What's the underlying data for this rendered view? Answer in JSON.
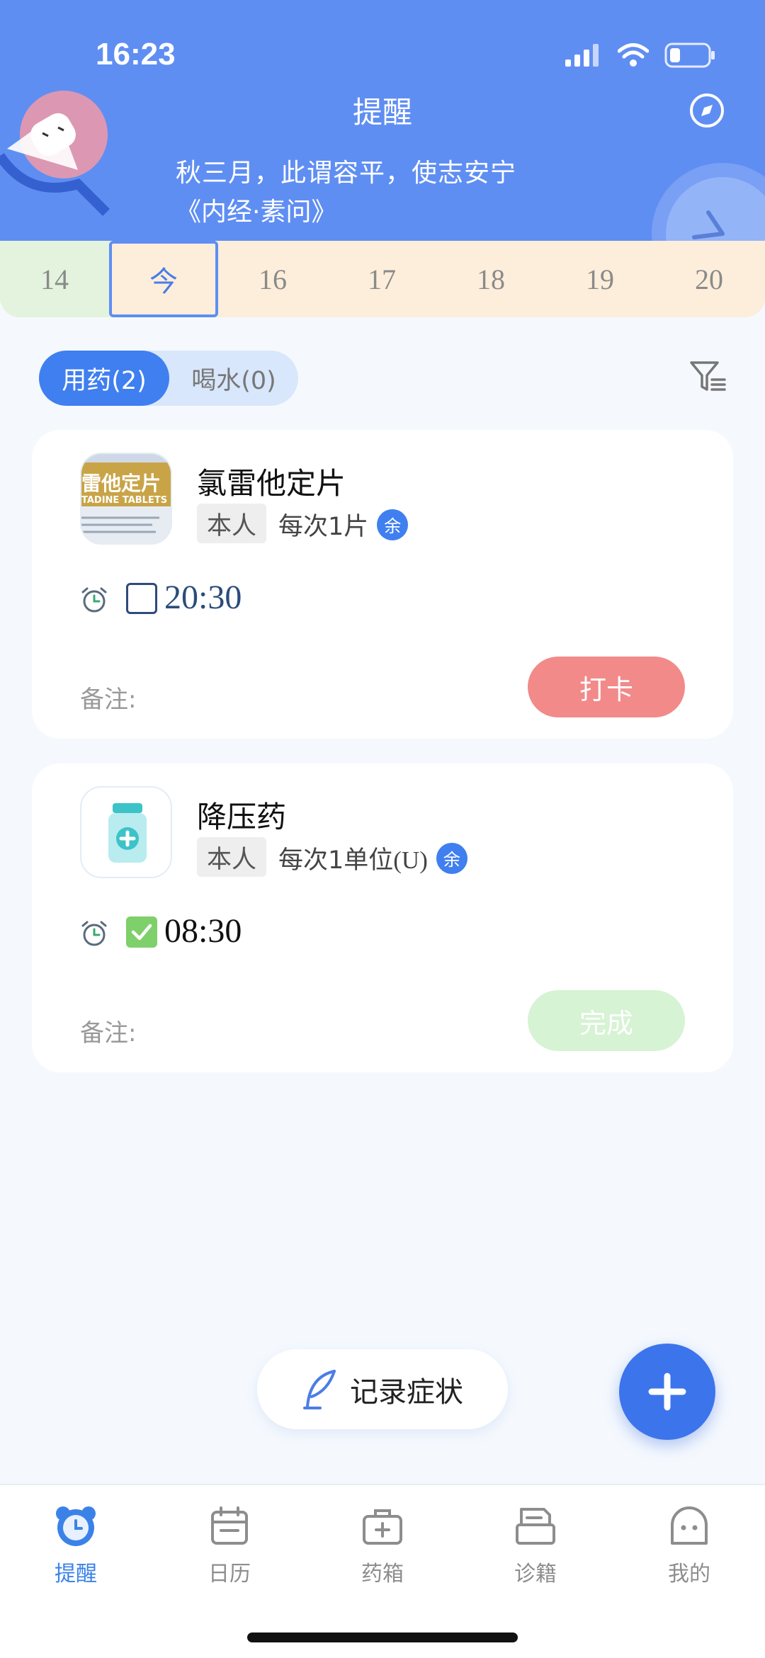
{
  "status_bar": {
    "time": "16:23"
  },
  "header": {
    "title": "提醒",
    "quote_line1": "秋三月，此谓容平，使志安宁",
    "quote_line2": "《内经·素问》"
  },
  "days": [
    "14",
    "今",
    "16",
    "17",
    "18",
    "19",
    "20"
  ],
  "tabs": {
    "medicine": "用药(2)",
    "water": "喝水(0)"
  },
  "cards": [
    {
      "thumb_line1": "雷他定片",
      "thumb_line2": "TADINE TABLETS",
      "name": "氯雷他定片",
      "tag": "本人",
      "dose_cn": "每次1片",
      "dose_unit": "",
      "badge": "余",
      "time": "20:30",
      "note": "备注:",
      "button": "打卡",
      "checked": false
    },
    {
      "name": "降压药",
      "tag": "本人",
      "dose_cn": "每次1单位",
      "dose_unit": "(U)",
      "badge": "余",
      "time": "08:30",
      "note": "备注:",
      "button": "完成",
      "checked": true
    }
  ],
  "record_button": "记录症状",
  "nav": [
    {
      "label": "提醒",
      "icon": "alarm-clock-icon",
      "active": true
    },
    {
      "label": "日历",
      "icon": "calendar-icon",
      "active": false
    },
    {
      "label": "药箱",
      "icon": "medicine-box-icon",
      "active": false
    },
    {
      "label": "诊籍",
      "icon": "records-icon",
      "active": false
    },
    {
      "label": "我的",
      "icon": "profile-icon",
      "active": false
    }
  ],
  "colors": {
    "header_bg": "#5f8ef3",
    "accent": "#3f7ff0",
    "punch": "#f28a8a",
    "done": "#d6f3d4",
    "nav_active": "#3b82e8"
  }
}
